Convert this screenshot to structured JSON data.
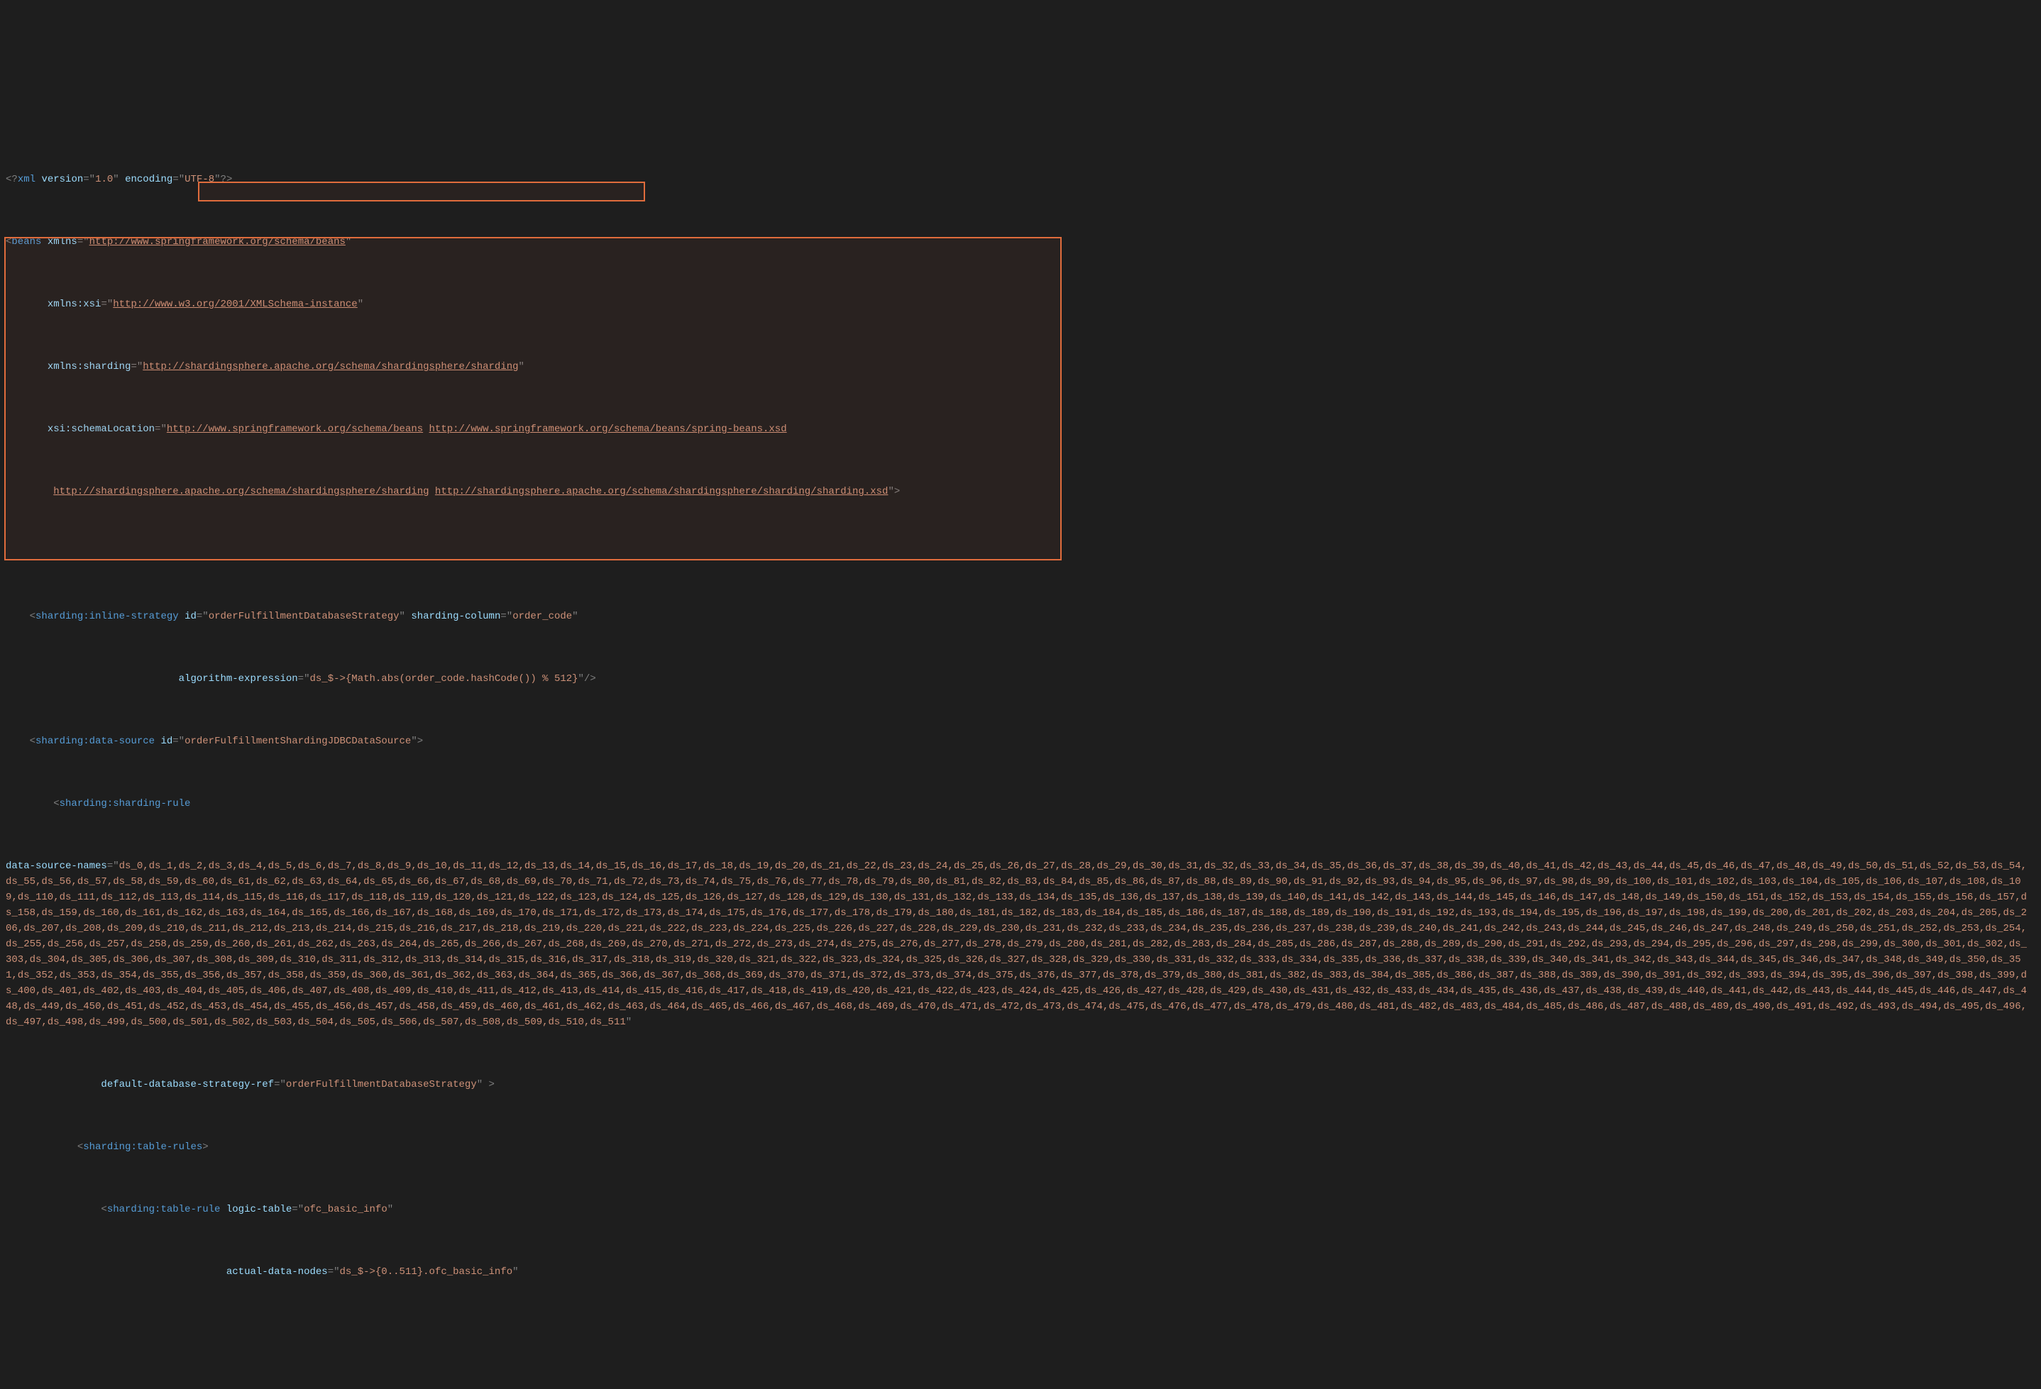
{
  "xml_decl": {
    "open": "<?",
    "name": "xml",
    "version_attr": "version",
    "version_val": "1.0",
    "encoding_attr": "encoding",
    "encoding_val": "UTF-8",
    "close": "?>"
  },
  "beans_open": {
    "open": "<",
    "tag": "beans",
    "xmlns_attr": "xmlns",
    "xmlns_val": "http://www.springframework.org/schema/beans",
    "xsi_attr": "xmlns:xsi",
    "xsi_val": "http://www.w3.org/2001/XMLSchema-instance",
    "sharding_attr": "xmlns:sharding",
    "sharding_val": "http://shardingsphere.apache.org/schema/shardingsphere/sharding",
    "loc_attr": "xsi:schemaLocation",
    "loc_val_1": "http://www.springframework.org/schema/beans",
    "loc_val_2": "http://www.springframework.org/schema/beans/spring-beans.xsd",
    "loc_val_3": "http://shardingsphere.apache.org/schema/shardingsphere/sharding",
    "loc_val_4": "http://shardingsphere.apache.org/schema/shardingsphere/sharding/sharding.xsd",
    "close": ">"
  },
  "inline_strategy": {
    "open": "<",
    "tag": "sharding:inline-strategy",
    "id_attr": "id",
    "id_val": "orderFulfillmentDatabaseStrategy",
    "col_attr": "sharding-column",
    "col_val": "order_code",
    "expr_attr": "algorithm-expression",
    "expr_val": "ds_$->{Math.abs(order_code.hashCode()) % 512}",
    "close": "/>"
  },
  "data_source": {
    "open": "<",
    "tag": "sharding:data-source",
    "id_attr": "id",
    "id_val": "orderFulfillmentShardingJDBCDataSource",
    "close": ">"
  },
  "sharding_rule": {
    "open": "<",
    "tag": "sharding:sharding-rule",
    "names_attr": "data-source-names",
    "ds_count": 512,
    "ds_prefix": "ds_",
    "strategy_ref_attr": "default-database-strategy-ref",
    "strategy_ref_val": "orderFulfillmentDatabaseStrategy",
    "close": ">"
  },
  "table_rules": {
    "open": "<",
    "tag": "sharding:table-rules",
    "close": ">"
  },
  "table_rule": {
    "open": "<",
    "tag": "sharding:table-rule",
    "logic_attr": "logic-table",
    "logic_val": "ofc_basic_info",
    "nodes_attr": "actual-data-nodes",
    "nodes_val": "ds_$->{0..511}.ofc_basic_info"
  },
  "q": "\""
}
